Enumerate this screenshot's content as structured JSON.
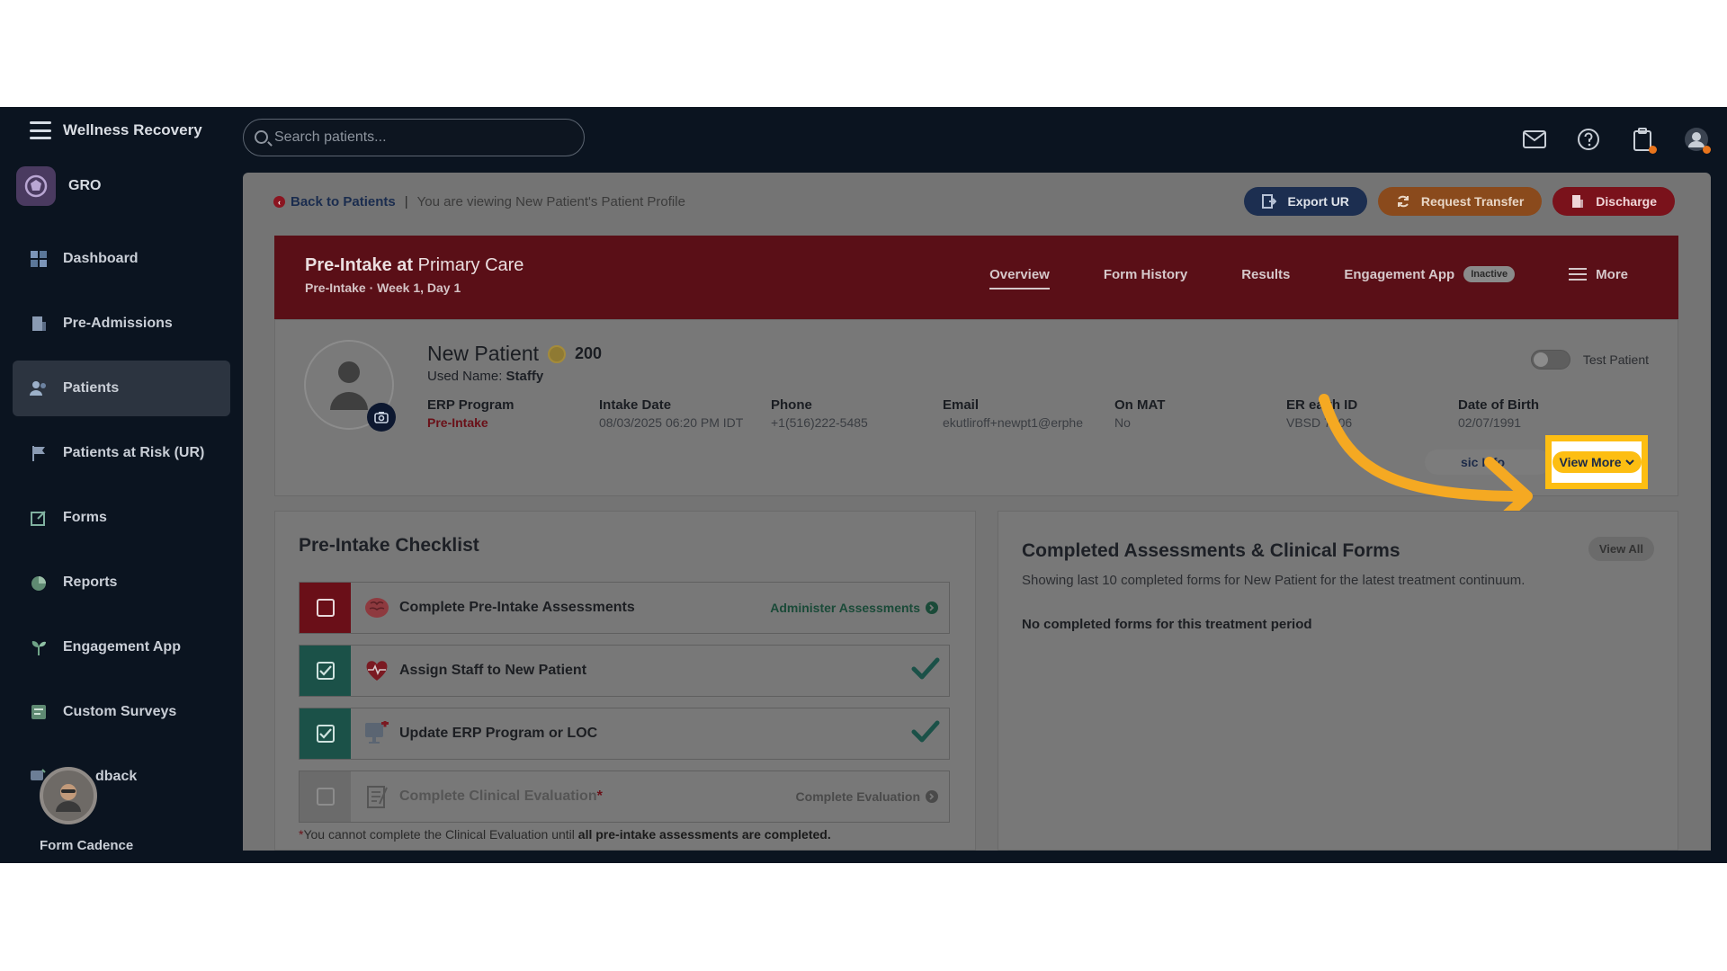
{
  "app": {
    "brand": "Wellness Recovery",
    "org": "GRO"
  },
  "search": {
    "placeholder": "Search patients..."
  },
  "sidebar": {
    "items": [
      {
        "label": "Dashboard"
      },
      {
        "label": "Pre-Admissions"
      },
      {
        "label": "Patients"
      },
      {
        "label": "Patients at Risk (UR)"
      },
      {
        "label": "Forms"
      },
      {
        "label": "Reports"
      },
      {
        "label": "Engagement App"
      },
      {
        "label": "Custom Surveys"
      },
      {
        "label": "dback"
      }
    ],
    "footer_label": "Form Cadence"
  },
  "breadcrumb": {
    "back": "Back to Patients",
    "separator": "|",
    "viewing": "You are viewing New Patient's Patient Profile"
  },
  "actions": {
    "export": "Export UR",
    "transfer": "Request Transfer",
    "discharge": "Discharge"
  },
  "banner": {
    "title_bold": "Pre-Intake at",
    "title_rest": " Primary Care",
    "subtitle": "Pre-Intake · Week 1, Day 1",
    "tabs": [
      "Overview",
      "Form History",
      "Results",
      "Engagement App",
      "More"
    ],
    "engagement_badge": "Inactive"
  },
  "patient": {
    "name": "New Patient",
    "points": "200",
    "used_name_label": "Used Name:",
    "used_name": "Staffy",
    "test_patient_label": "Test Patient",
    "fields": [
      {
        "label": "ERP Program",
        "value": "Pre-Intake"
      },
      {
        "label": "Intake Date",
        "value": "08/03/2025 06:20 PM IDT"
      },
      {
        "label": "Phone",
        "value": "+1(516)222-5485"
      },
      {
        "label": "Email",
        "value": "ekutliroff+newpt1@erphe"
      },
      {
        "label": "On MAT",
        "value": "No"
      },
      {
        "label": "ER  ealth ID",
        "value": "VBSD  7906"
      },
      {
        "label": "Date of Birth",
        "value": "02/07/1991"
      }
    ],
    "basic_info": "sic Info",
    "view_more": "View More"
  },
  "checklist": {
    "title": "Pre-Intake Checklist",
    "items": [
      {
        "label": "Complete Pre-Intake Assessments",
        "action": "Administer Assessments"
      },
      {
        "label": "Assign Staff to New Patient"
      },
      {
        "label": "Update ERP Program or LOC"
      },
      {
        "label": "Complete Clinical Evaluation",
        "required": "*",
        "action": "Complete Evaluation"
      }
    ],
    "note_star": "*",
    "note_text": "You cannot complete the Clinical Evaluation until ",
    "note_bold": "all pre-intake assessments are completed."
  },
  "completed": {
    "title": "Completed Assessments & Clinical Forms",
    "view_all": "View All",
    "description": "Showing last 10 completed forms for New Patient for the latest treatment continuum.",
    "empty": "No completed forms for this treatment period"
  },
  "colors": {
    "highlight": "#fdbe12",
    "arrow": "#f5a922",
    "banner": "#5a0f17",
    "checklist_done": "#1b5148"
  }
}
